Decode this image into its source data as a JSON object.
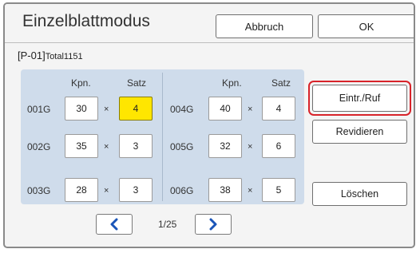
{
  "header": {
    "title": "Einzelblattmodus",
    "cancel_label": "Abbruch",
    "ok_label": "OK"
  },
  "program": {
    "id": "[P-01]",
    "total": "Total1151"
  },
  "columns": {
    "copies": "Kpn.",
    "sets": "Satz",
    "times": "×"
  },
  "groups": [
    {
      "label": "001G",
      "copies": "30",
      "sets": "4",
      "active_field": "sets"
    },
    {
      "label": "002G",
      "copies": "35",
      "sets": "3"
    },
    {
      "label": "003G",
      "copies": "28",
      "sets": "3"
    },
    {
      "label": "004G",
      "copies": "40",
      "sets": "4"
    },
    {
      "label": "005G",
      "copies": "32",
      "sets": "6"
    },
    {
      "label": "006G",
      "copies": "38",
      "sets": "5"
    }
  ],
  "pager": {
    "indicator": "1/25",
    "prev_icon": "chevron-left-icon",
    "next_icon": "chevron-right-icon"
  },
  "side": {
    "entry_label": "Eintr./Ruf",
    "revise_label": "Revidieren",
    "delete_label": "Löschen"
  },
  "colors": {
    "accent": "#1a55b8",
    "highlight": "#ffe600",
    "callout": "#d8232a",
    "grid_bg": "#cfdceb"
  }
}
